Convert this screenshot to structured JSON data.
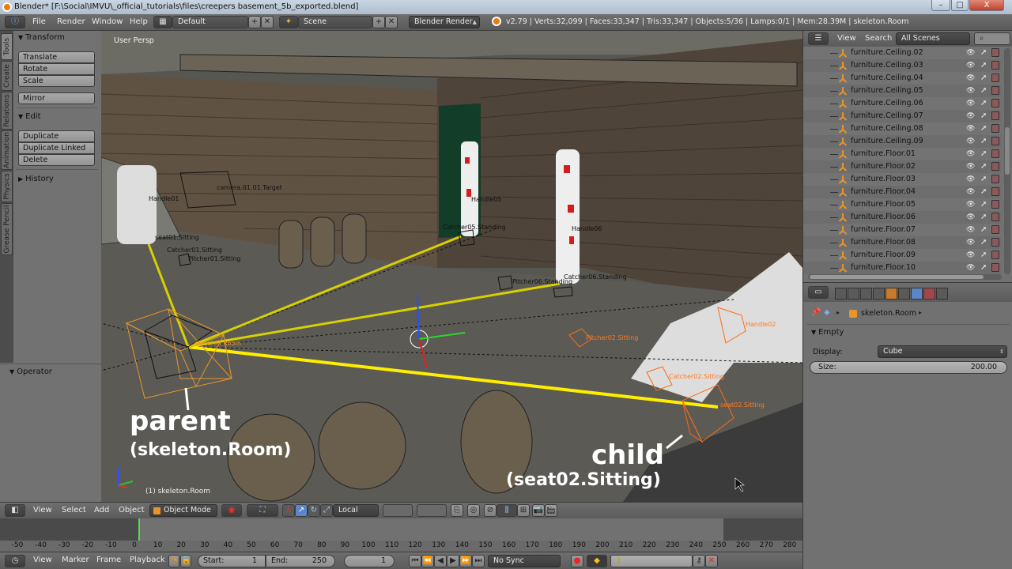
{
  "window": {
    "title": "Blender* [F:\\Social\\IMVU\\_official_tutorials\\files\\creepers basement_5b_exported.blend]",
    "controls": {
      "minimize": "–",
      "maximize": "□",
      "close": "X"
    }
  },
  "topbar": {
    "info_icon": "info-icon",
    "menus": [
      "File",
      "Render",
      "Window",
      "Help"
    ],
    "screen_layout": "Default",
    "scene": "Scene",
    "render_engine": "Blender Render",
    "stats": "v2.79 | Verts:32,099 | Faces:33,347 | Tris:33,347 | Objects:5/36 | Lamps:0/1 | Mem:28.39M | skeleton.Room"
  },
  "toolshelf": {
    "tabs": [
      "Tools",
      "Create",
      "Relations",
      "Animation",
      "Physics",
      "Grease Pencil"
    ],
    "active_tab": "Tools",
    "panels": {
      "transform": {
        "title": "Transform",
        "buttons": [
          "Translate",
          "Rotate",
          "Scale"
        ],
        "mirror": "Mirror"
      },
      "edit": {
        "title": "Edit",
        "buttons": [
          "Duplicate",
          "Duplicate Linked",
          "Delete"
        ]
      },
      "history": {
        "title": "History"
      }
    },
    "operator": "Operator"
  },
  "viewport": {
    "view_label": "User Persp",
    "object_info": "(1) skeleton.Room",
    "object_labels": [
      {
        "text": "camera.01.01.Target",
        "selected": false
      },
      {
        "text": "Handle01",
        "selected": false
      },
      {
        "text": "seat01.Sitting",
        "selected": false
      },
      {
        "text": "Catcher01.Sitting",
        "selected": false
      },
      {
        "text": "Pitcher01.Sitting",
        "selected": false
      },
      {
        "text": "Handle05",
        "selected": false
      },
      {
        "text": "Catcher05.Standing",
        "selected": false
      },
      {
        "text": "Handle06",
        "selected": false
      },
      {
        "text": "Pitcher06.Standing",
        "selected": false
      },
      {
        "text": "Catcher06.Standing",
        "selected": false
      },
      {
        "text": "Handle02",
        "selected": true
      },
      {
        "text": "Pitcher02.Sitting",
        "selected": true
      },
      {
        "text": "Catcher02.Sitting",
        "selected": true
      },
      {
        "text": "seat02.Sitting",
        "selected": true
      },
      {
        "text": "skeleton.Room",
        "selected": true
      }
    ],
    "annotations": {
      "parent_title": "parent",
      "parent_sub": "(skeleton.Room)",
      "child_title": "child",
      "child_sub": "(seat02.Sitting)"
    },
    "colors": {
      "relationship_line": "#ffee00",
      "selected": "#ff7a20",
      "active_parent": "#e8952a"
    }
  },
  "view3d_header": {
    "menus": [
      "View",
      "Select",
      "Add",
      "Object"
    ],
    "mode": "Object Mode",
    "transform_orientation": "Local"
  },
  "timeline": {
    "ruler_ticks": [
      "-50",
      "-40",
      "-30",
      "-20",
      "-10",
      "0",
      "10",
      "20",
      "30",
      "40",
      "50",
      "60",
      "70",
      "80",
      "90",
      "100",
      "110",
      "120",
      "130",
      "140",
      "150",
      "160",
      "170",
      "180",
      "190",
      "200",
      "210",
      "220",
      "230",
      "240",
      "250",
      "260",
      "270",
      "280"
    ],
    "current_frame_marker": "0",
    "menus": [
      "View",
      "Marker",
      "Frame",
      "Playback"
    ],
    "start_label": "Start:",
    "start_value": "1",
    "end_label": "End:",
    "end_value": "250",
    "current_frame": "1",
    "sync": "No Sync"
  },
  "outliner": {
    "menus": [
      "View",
      "Search"
    ],
    "filter": "All Scenes",
    "items": [
      "furniture.Ceiling.02",
      "furniture.Ceiling.03",
      "furniture.Ceiling.04",
      "furniture.Ceiling.05",
      "furniture.Ceiling.06",
      "furniture.Ceiling.07",
      "furniture.Ceiling.08",
      "furniture.Ceiling.09",
      "furniture.Floor.01",
      "furniture.Floor.02",
      "furniture.Floor.03",
      "furniture.Floor.04",
      "furniture.Floor.05",
      "furniture.Floor.06",
      "furniture.Floor.07",
      "furniture.Floor.08",
      "furniture.Floor.09",
      "furniture.Floor.10"
    ]
  },
  "properties": {
    "tabs": [
      "render",
      "render-layers",
      "scene",
      "world",
      "object",
      "constraints",
      "data",
      "texture",
      "physics"
    ],
    "active_tab": "data",
    "breadcrumb_object": "skeleton.Room",
    "panel_title": "Empty",
    "display_label": "Display:",
    "display_value": "Cube",
    "size_label": "Size:",
    "size_value": "200.00"
  }
}
